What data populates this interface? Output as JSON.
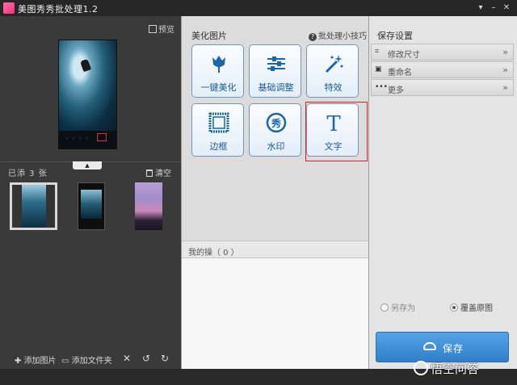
{
  "window": {
    "title": "美图秀秀批处理1.2",
    "controls": [
      "settings-icon",
      "minimize-icon",
      "close-icon"
    ]
  },
  "preview": {
    "button_label": "预览",
    "icon": "preview-icon"
  },
  "thumbnails": {
    "count_label": "已添 3 张",
    "clear_label": "清空",
    "items": [
      {
        "name": "surfer-wave",
        "selected": true
      },
      {
        "name": "phone-screenshot",
        "selected": false
      },
      {
        "name": "purple-lake",
        "selected": false
      }
    ]
  },
  "bottom_toolbar": {
    "add_image": "添加图片",
    "add_folder": "添加文件夹",
    "icons": [
      "delete-icon",
      "rotate-left-icon",
      "rotate-right-icon"
    ]
  },
  "beautify": {
    "title": "美化图片",
    "tips": "批处理小技巧",
    "tools": [
      {
        "label": "一键美化",
        "icon": "tulip-icon"
      },
      {
        "label": "基础调整",
        "icon": "sliders-icon"
      },
      {
        "label": "特效",
        "icon": "magic-wand-icon"
      },
      {
        "label": "边框",
        "icon": "frame-icon"
      },
      {
        "label": "水印",
        "icon": "watermark-xiu-icon",
        "glyph": "秀"
      },
      {
        "label": "文字",
        "icon": "text-t-icon",
        "glyph": "T",
        "highlighted": true
      }
    ],
    "highlight_color": "#e0202a"
  },
  "operations": {
    "header": "我的操（ 0 ）"
  },
  "save_settings": {
    "title": "保存设置",
    "rows": [
      {
        "label": "修改尺寸",
        "icon": "crop-icon"
      },
      {
        "label": "重命名",
        "icon": "rename-icon"
      },
      {
        "label": "更多",
        "icon": "more-icon"
      }
    ],
    "radio": [
      {
        "label": "另存为",
        "checked": false
      },
      {
        "label": "覆盖原图",
        "checked": true
      }
    ],
    "save_label": "保存",
    "accent": "#3a8ad6"
  },
  "watermark": {
    "text": "悟空问答"
  }
}
